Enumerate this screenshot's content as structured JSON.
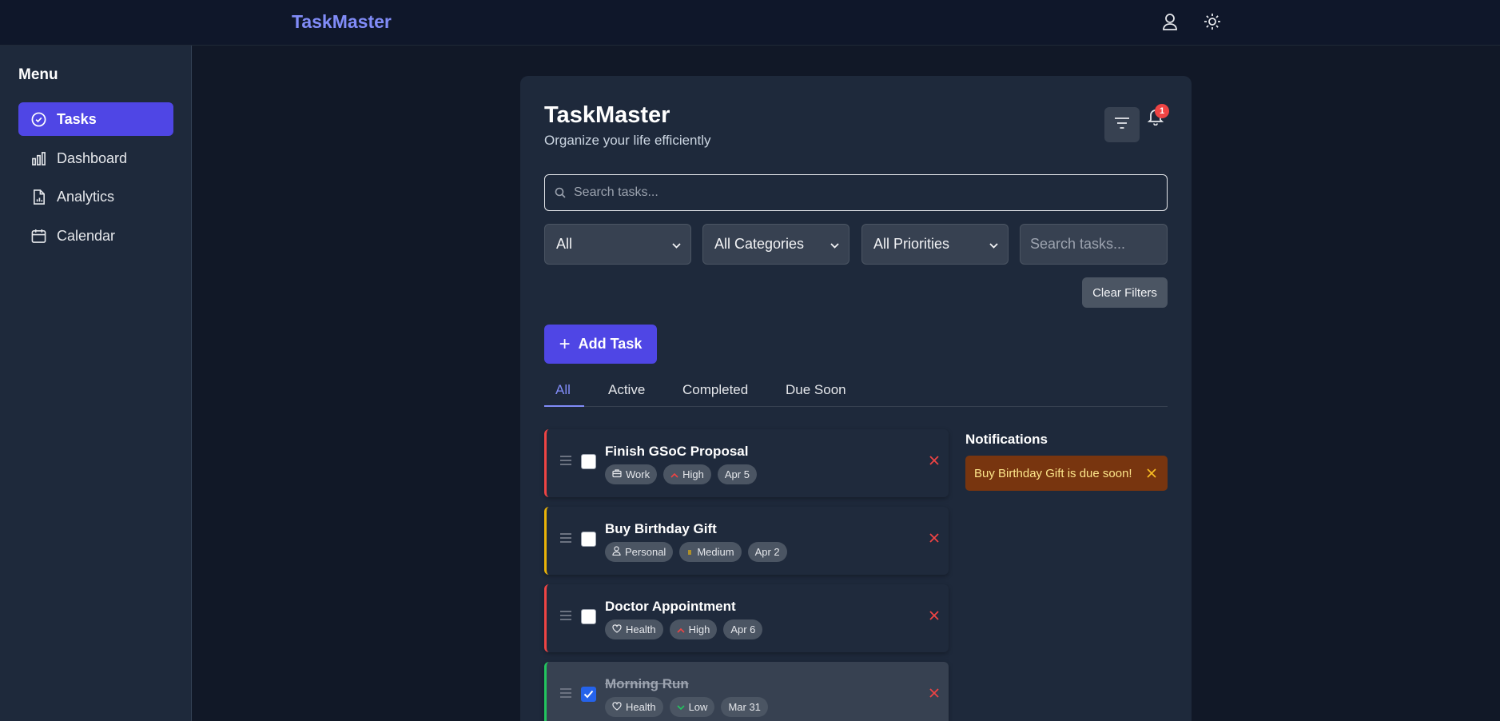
{
  "header": {
    "brand": "TaskMaster",
    "icons": [
      "user-icon",
      "sun-icon"
    ]
  },
  "sidebar": {
    "title": "Menu",
    "items": [
      {
        "label": "Tasks",
        "icon": "check-circle-icon",
        "active": true
      },
      {
        "label": "Dashboard",
        "icon": "bar-chart-icon",
        "active": false
      },
      {
        "label": "Analytics",
        "icon": "file-chart-icon",
        "active": false
      },
      {
        "label": "Calendar",
        "icon": "calendar-icon",
        "active": false
      }
    ]
  },
  "main": {
    "title": "TaskMaster",
    "subtitle": "Organize your life efficiently",
    "notification_count": "1",
    "search_placeholder": "Search tasks...",
    "filters": {
      "status": "All",
      "category": "All Categories",
      "priority": "All Priorities",
      "search_placeholder": "Search tasks..."
    },
    "clear_filters": "Clear Filters",
    "add_task": "Add Task",
    "tabs": [
      "All",
      "Active",
      "Completed",
      "Due Soon"
    ],
    "active_tab": "All",
    "tasks": [
      {
        "name": "Finish GSoC Proposal",
        "category": "Work",
        "priority": "High",
        "due": "Apr 5",
        "completed": false,
        "accent": "#ef4444"
      },
      {
        "name": "Buy Birthday Gift",
        "category": "Personal",
        "priority": "Medium",
        "due": "Apr 2",
        "completed": false,
        "accent": "#eab308"
      },
      {
        "name": "Doctor Appointment",
        "category": "Health",
        "priority": "High",
        "due": "Apr 6",
        "completed": false,
        "accent": "#ef4444"
      },
      {
        "name": "Morning Run",
        "category": "Health",
        "priority": "Low",
        "due": "Mar 31",
        "completed": true,
        "accent": "#22c55e"
      }
    ],
    "notifications": {
      "title": "Notifications",
      "items": [
        {
          "text": "Buy Birthday Gift is due soon!"
        }
      ]
    }
  },
  "colors": {
    "accent": "#4f46e5",
    "accent_text": "#818cf8",
    "background": "#111827",
    "card": "#1e293b"
  }
}
